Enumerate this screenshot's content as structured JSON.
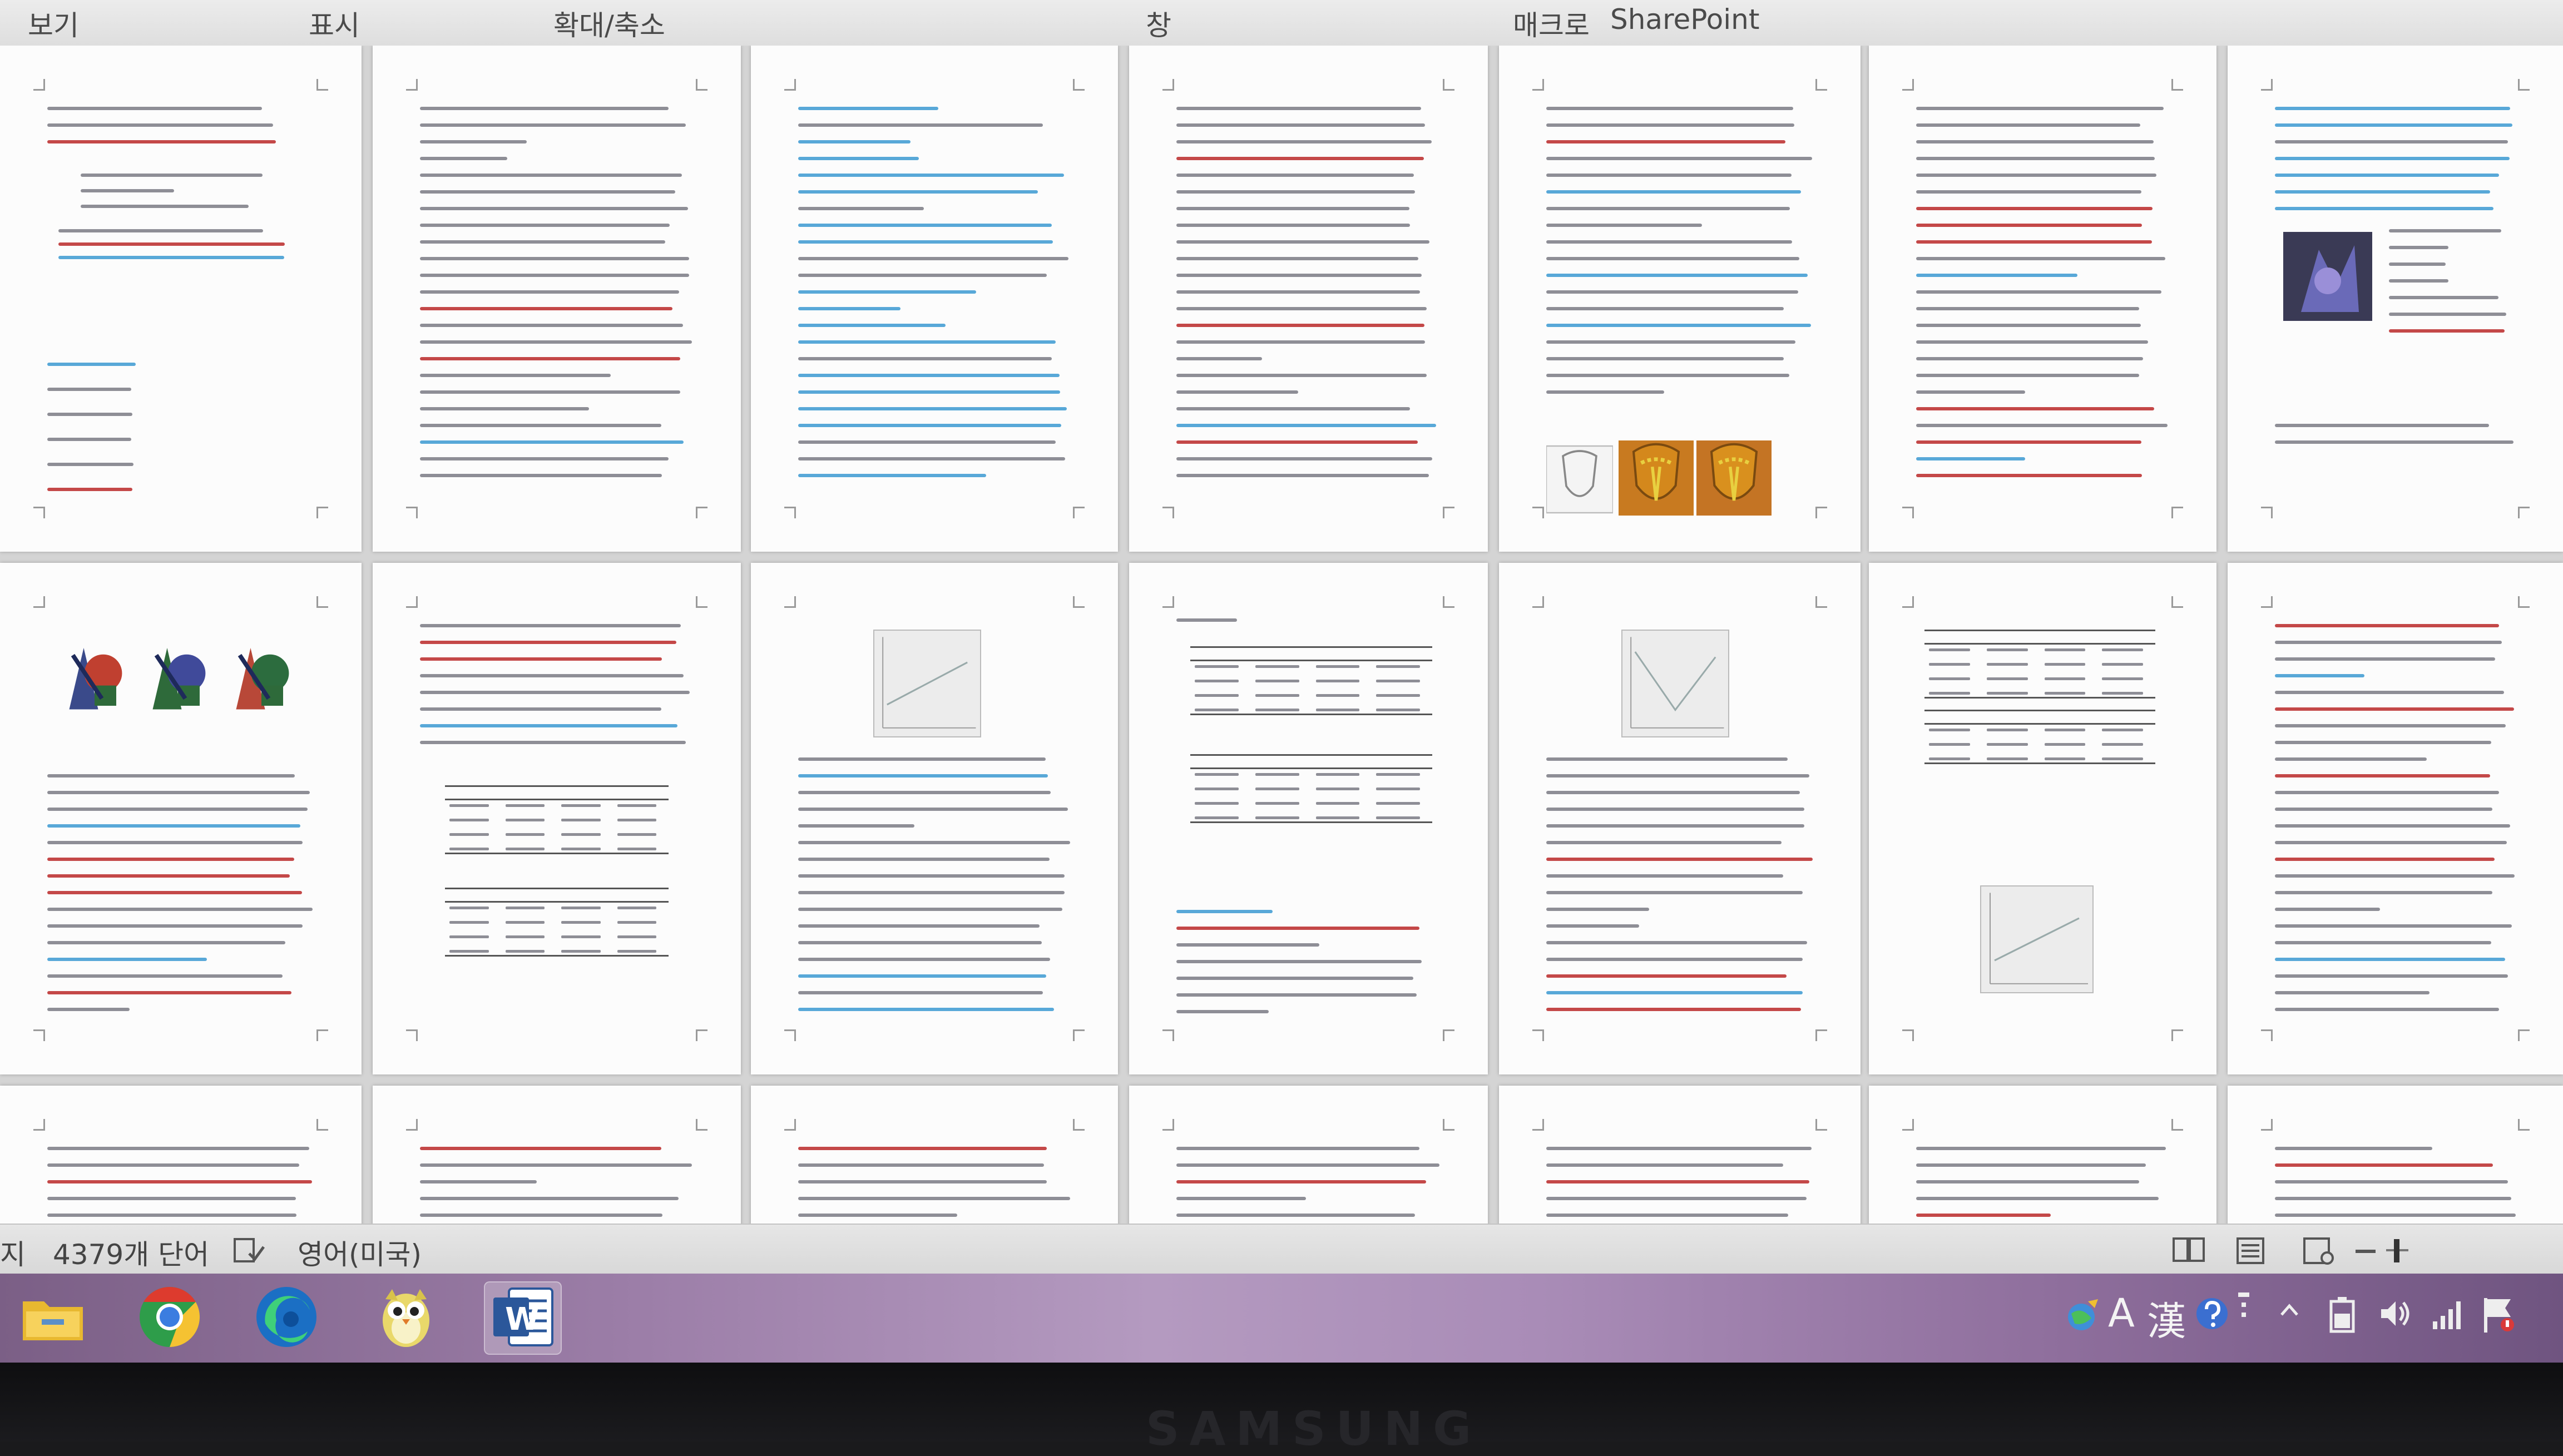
{
  "ribbon": {
    "tabs": [
      {
        "label": "보기"
      },
      {
        "label": "표시"
      },
      {
        "label": "확대/축소"
      },
      {
        "label": "창"
      },
      {
        "label": "매크로"
      },
      {
        "label": "SharePoint"
      }
    ]
  },
  "status_bar": {
    "left_fragment": "지",
    "word_count": "4379개 단어",
    "language": "영어(미국)"
  },
  "taskbar": {
    "apps": [
      {
        "name": "file-explorer-app",
        "icon": "folder-icon"
      },
      {
        "name": "chrome-app",
        "icon": "chrome-icon"
      },
      {
        "name": "edge-app",
        "icon": "edge-icon"
      },
      {
        "name": "bird-mascot-app",
        "icon": "owl-icon"
      },
      {
        "name": "word-app",
        "icon": "word-icon",
        "label": "W",
        "active": true
      }
    ],
    "tray": {
      "ime_mode": "A",
      "hanja_label": "漢"
    }
  },
  "monitor": {
    "brand": "SAMSUNG"
  },
  "colors": {
    "ribbon_bg": "#e4e4e4",
    "workspace_bg": "#d4d4d4",
    "page_bg": "#fcfcfc",
    "body_text": "#8e8e96",
    "tracked_change_blue": "#58a8d8",
    "spellcheck_red": "#c44848",
    "taskbar_purple": "#9c7ea8",
    "word_blue": "#2b579a"
  }
}
